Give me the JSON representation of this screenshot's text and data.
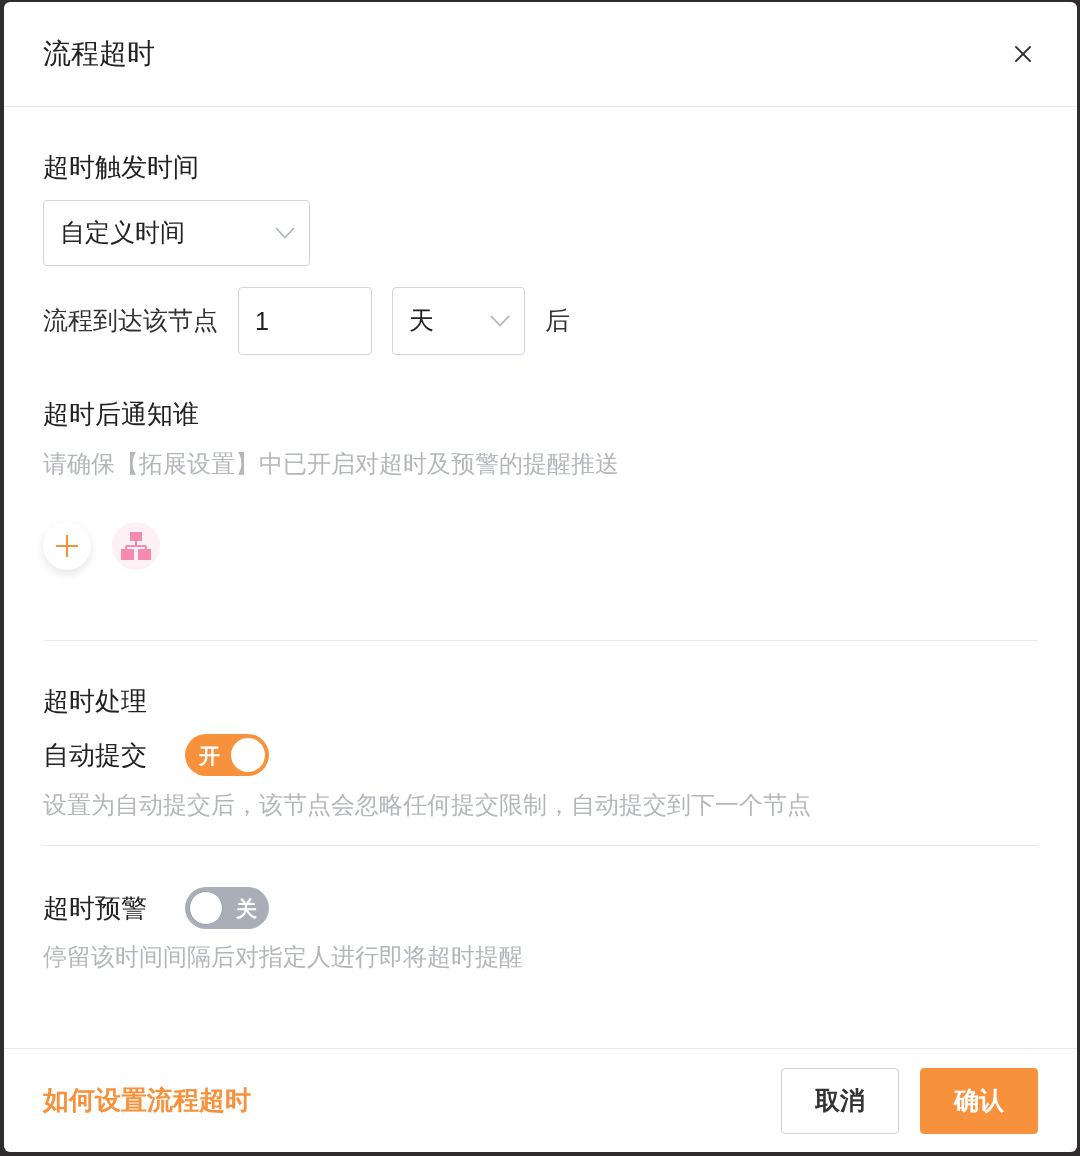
{
  "dialog": {
    "title": "流程超时"
  },
  "trigger": {
    "label": "超时触发时间",
    "mode_select": {
      "value": "自定义时间"
    },
    "arrival": {
      "label": "流程到达该节点",
      "amount": {
        "value": "1"
      },
      "unit_select": {
        "value": "天"
      },
      "suffix": "后"
    }
  },
  "notify": {
    "label": "超时后通知谁",
    "hint": "请确保【拓展设置】中已开启对超时及预警的提醒推送",
    "actions": [
      {
        "kind": "add"
      },
      {
        "kind": "org"
      }
    ]
  },
  "timeout_handling": {
    "title": "超时处理",
    "auto_submit": {
      "label": "自动提交",
      "on": true,
      "state_text": "开",
      "hint": "设置为自动提交后，该节点会忽略任何提交限制，自动提交到下一个节点"
    }
  },
  "timeout_warning": {
    "label": "超时预警",
    "on": false,
    "state_text": "关",
    "hint": "停留该时间间隔后对指定人进行即将超时提醒"
  },
  "footer": {
    "help_link": "如何设置流程超时",
    "buttons": [
      {
        "label": "取消",
        "kind": "secondary"
      },
      {
        "label": "确认",
        "kind": "primary"
      }
    ]
  }
}
